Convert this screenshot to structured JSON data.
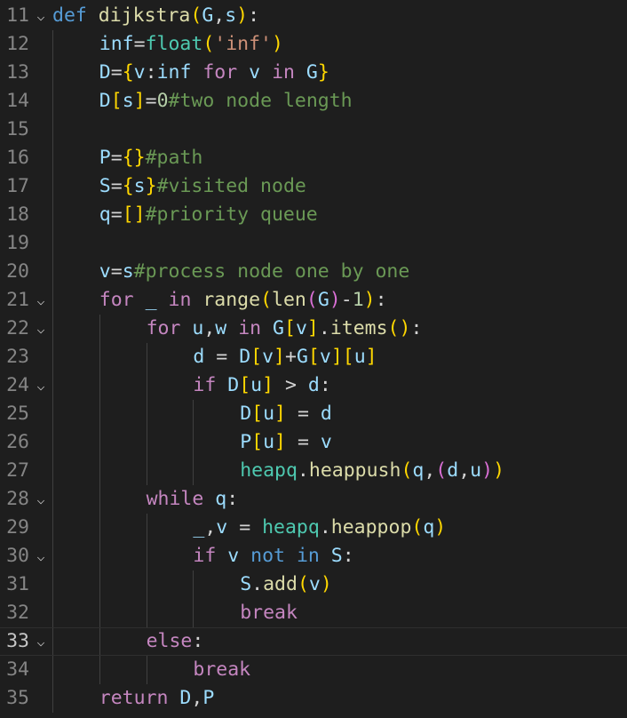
{
  "editor": {
    "language": "python",
    "active_line": 33,
    "colors": {
      "background": "#1e1e1e",
      "keyword": "#569cd6",
      "function": "#dcdcaa",
      "variable": "#9cdcfe",
      "control": "#c586c0",
      "string": "#ce9178",
      "number": "#b5cea8",
      "comment": "#6a9955",
      "module": "#4ec9b0",
      "bracket_level1": "#ffd700",
      "bracket_level2": "#da70d6",
      "bracket_level3": "#179fff"
    },
    "lines": [
      {
        "num": "11",
        "fold": true,
        "tokens": [
          [
            "kw",
            "def"
          ],
          [
            "plain",
            " "
          ],
          [
            "fn",
            "dijkstra"
          ],
          [
            "b1",
            "("
          ],
          [
            "var",
            "G"
          ],
          [
            "plain",
            ","
          ],
          [
            "var",
            "s"
          ],
          [
            "b1",
            ")"
          ],
          [
            "plain",
            ":"
          ]
        ]
      },
      {
        "num": "12",
        "fold": false,
        "tokens": [
          [
            "var",
            "inf"
          ],
          [
            "plain",
            "="
          ],
          [
            "cls",
            "float"
          ],
          [
            "b1",
            "("
          ],
          [
            "str",
            "'inf'"
          ],
          [
            "b1",
            ")"
          ]
        ]
      },
      {
        "num": "13",
        "fold": false,
        "tokens": [
          [
            "var",
            "D"
          ],
          [
            "plain",
            "="
          ],
          [
            "b1",
            "{"
          ],
          [
            "var",
            "v"
          ],
          [
            "plain",
            ":"
          ],
          [
            "var",
            "inf"
          ],
          [
            "plain",
            " "
          ],
          [
            "ctl",
            "for"
          ],
          [
            "plain",
            " "
          ],
          [
            "var",
            "v"
          ],
          [
            "plain",
            " "
          ],
          [
            "ctl",
            "in"
          ],
          [
            "plain",
            " "
          ],
          [
            "var",
            "G"
          ],
          [
            "b1",
            "}"
          ]
        ]
      },
      {
        "num": "14",
        "fold": false,
        "tokens": [
          [
            "var",
            "D"
          ],
          [
            "b1",
            "["
          ],
          [
            "var",
            "s"
          ],
          [
            "b1",
            "]"
          ],
          [
            "plain",
            "="
          ],
          [
            "num",
            "0"
          ],
          [
            "cmt",
            "#two node length"
          ]
        ]
      },
      {
        "num": "15",
        "fold": false,
        "tokens": []
      },
      {
        "num": "16",
        "fold": false,
        "tokens": [
          [
            "var",
            "P"
          ],
          [
            "plain",
            "="
          ],
          [
            "b1",
            "{}"
          ],
          [
            "cmt",
            "#path"
          ]
        ]
      },
      {
        "num": "17",
        "fold": false,
        "tokens": [
          [
            "var",
            "S"
          ],
          [
            "plain",
            "="
          ],
          [
            "b1",
            "{"
          ],
          [
            "var",
            "s"
          ],
          [
            "b1",
            "}"
          ],
          [
            "cmt",
            "#visited node"
          ]
        ]
      },
      {
        "num": "18",
        "fold": false,
        "tokens": [
          [
            "var",
            "q"
          ],
          [
            "plain",
            "="
          ],
          [
            "b1",
            "[]"
          ],
          [
            "cmt",
            "#priority queue"
          ]
        ]
      },
      {
        "num": "19",
        "fold": false,
        "tokens": []
      },
      {
        "num": "20",
        "fold": false,
        "tokens": [
          [
            "var",
            "v"
          ],
          [
            "plain",
            "="
          ],
          [
            "var",
            "s"
          ],
          [
            "cmt",
            "#process node one by one"
          ]
        ]
      },
      {
        "num": "21",
        "fold": true,
        "tokens": [
          [
            "ctl",
            "for"
          ],
          [
            "plain",
            " "
          ],
          [
            "var",
            "_"
          ],
          [
            "plain",
            " "
          ],
          [
            "ctl",
            "in"
          ],
          [
            "plain",
            " "
          ],
          [
            "fn",
            "range"
          ],
          [
            "b1",
            "("
          ],
          [
            "fn",
            "len"
          ],
          [
            "b2",
            "("
          ],
          [
            "var",
            "G"
          ],
          [
            "b2",
            ")"
          ],
          [
            "plain",
            "-"
          ],
          [
            "num",
            "1"
          ],
          [
            "b1",
            ")"
          ],
          [
            "plain",
            ":"
          ]
        ]
      },
      {
        "num": "22",
        "fold": true,
        "tokens": [
          [
            "ctl",
            "for"
          ],
          [
            "plain",
            " "
          ],
          [
            "var",
            "u"
          ],
          [
            "plain",
            ","
          ],
          [
            "var",
            "w"
          ],
          [
            "plain",
            " "
          ],
          [
            "ctl",
            "in"
          ],
          [
            "plain",
            " "
          ],
          [
            "var",
            "G"
          ],
          [
            "b1",
            "["
          ],
          [
            "var",
            "v"
          ],
          [
            "b1",
            "]"
          ],
          [
            "plain",
            "."
          ],
          [
            "fn",
            "items"
          ],
          [
            "b1",
            "()"
          ],
          [
            "plain",
            ":"
          ]
        ]
      },
      {
        "num": "23",
        "fold": false,
        "tokens": [
          [
            "var",
            "d"
          ],
          [
            "plain",
            " = "
          ],
          [
            "var",
            "D"
          ],
          [
            "b1",
            "["
          ],
          [
            "var",
            "v"
          ],
          [
            "b1",
            "]"
          ],
          [
            "plain",
            "+"
          ],
          [
            "var",
            "G"
          ],
          [
            "b1",
            "["
          ],
          [
            "var",
            "v"
          ],
          [
            "b1",
            "]["
          ],
          [
            "var",
            "u"
          ],
          [
            "b1",
            "]"
          ]
        ]
      },
      {
        "num": "24",
        "fold": true,
        "tokens": [
          [
            "ctl",
            "if"
          ],
          [
            "plain",
            " "
          ],
          [
            "var",
            "D"
          ],
          [
            "b1",
            "["
          ],
          [
            "var",
            "u"
          ],
          [
            "b1",
            "]"
          ],
          [
            "plain",
            " > "
          ],
          [
            "var",
            "d"
          ],
          [
            "plain",
            ":"
          ]
        ]
      },
      {
        "num": "25",
        "fold": false,
        "tokens": [
          [
            "var",
            "D"
          ],
          [
            "b1",
            "["
          ],
          [
            "var",
            "u"
          ],
          [
            "b1",
            "]"
          ],
          [
            "plain",
            " = "
          ],
          [
            "var",
            "d"
          ]
        ]
      },
      {
        "num": "26",
        "fold": false,
        "tokens": [
          [
            "var",
            "P"
          ],
          [
            "b1",
            "["
          ],
          [
            "var",
            "u"
          ],
          [
            "b1",
            "]"
          ],
          [
            "plain",
            " = "
          ],
          [
            "var",
            "v"
          ]
        ]
      },
      {
        "num": "27",
        "fold": false,
        "tokens": [
          [
            "cls",
            "heapq"
          ],
          [
            "plain",
            "."
          ],
          [
            "fn",
            "heappush"
          ],
          [
            "b1",
            "("
          ],
          [
            "var",
            "q"
          ],
          [
            "plain",
            ","
          ],
          [
            "b2",
            "("
          ],
          [
            "var",
            "d"
          ],
          [
            "plain",
            ","
          ],
          [
            "var",
            "u"
          ],
          [
            "b2",
            ")"
          ],
          [
            "b1",
            ")"
          ]
        ]
      },
      {
        "num": "28",
        "fold": true,
        "tokens": [
          [
            "ctl",
            "while"
          ],
          [
            "plain",
            " "
          ],
          [
            "var",
            "q"
          ],
          [
            "plain",
            ":"
          ]
        ]
      },
      {
        "num": "29",
        "fold": false,
        "tokens": [
          [
            "var",
            "_"
          ],
          [
            "plain",
            ","
          ],
          [
            "var",
            "v"
          ],
          [
            "plain",
            " = "
          ],
          [
            "cls",
            "heapq"
          ],
          [
            "plain",
            "."
          ],
          [
            "fn",
            "heappop"
          ],
          [
            "b1",
            "("
          ],
          [
            "var",
            "q"
          ],
          [
            "b1",
            ")"
          ]
        ]
      },
      {
        "num": "30",
        "fold": true,
        "tokens": [
          [
            "ctl",
            "if"
          ],
          [
            "plain",
            " "
          ],
          [
            "var",
            "v"
          ],
          [
            "plain",
            " "
          ],
          [
            "kw",
            "not"
          ],
          [
            "plain",
            " "
          ],
          [
            "kw",
            "in"
          ],
          [
            "plain",
            " "
          ],
          [
            "var",
            "S"
          ],
          [
            "plain",
            ":"
          ]
        ]
      },
      {
        "num": "31",
        "fold": false,
        "tokens": [
          [
            "var",
            "S"
          ],
          [
            "plain",
            "."
          ],
          [
            "fn",
            "add"
          ],
          [
            "b1",
            "("
          ],
          [
            "var",
            "v"
          ],
          [
            "b1",
            ")"
          ]
        ]
      },
      {
        "num": "32",
        "fold": false,
        "tokens": [
          [
            "ctl",
            "break"
          ]
        ]
      },
      {
        "num": "33",
        "fold": true,
        "tokens": [
          [
            "ctl",
            "else"
          ],
          [
            "plain",
            ":"
          ]
        ]
      },
      {
        "num": "34",
        "fold": false,
        "tokens": [
          [
            "ctl",
            "break"
          ]
        ]
      },
      {
        "num": "35",
        "fold": false,
        "tokens": [
          [
            "ctl",
            "return"
          ],
          [
            "plain",
            " "
          ],
          [
            "var",
            "D"
          ],
          [
            "plain",
            ","
          ],
          [
            "var",
            "P"
          ]
        ]
      }
    ]
  }
}
